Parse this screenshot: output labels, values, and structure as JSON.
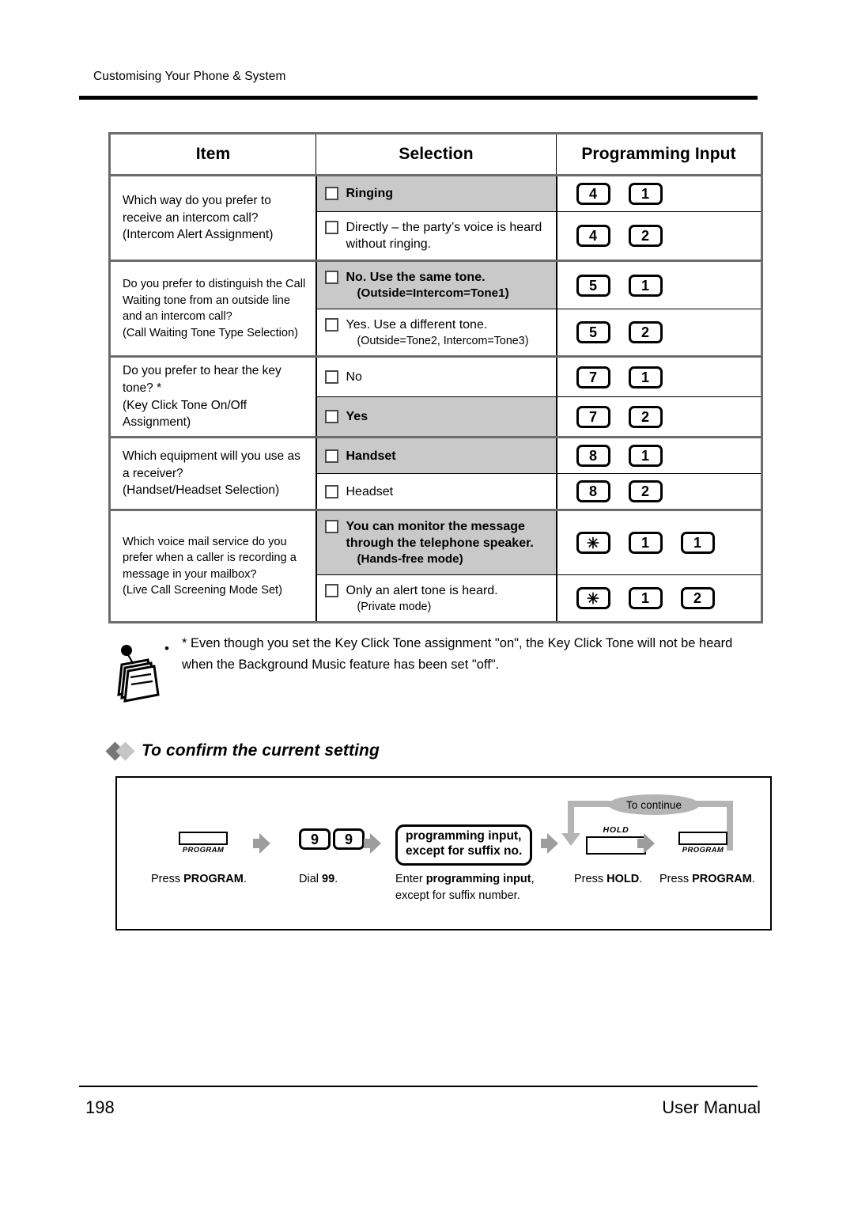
{
  "header": {
    "breadcrumb": "Customising Your Phone & System"
  },
  "table": {
    "columns": [
      "Item",
      "Selection",
      "Programming Input"
    ],
    "rows": [
      {
        "item": "Which way do you prefer to receive an intercom call?",
        "item_sub": "(Intercom Alert Assignment)",
        "options": [
          {
            "label": "Ringing",
            "sub": "",
            "bold": true,
            "shaded": true,
            "keys": [
              "4",
              "1"
            ]
          },
          {
            "label": "Directly – the party’s voice is heard without ringing.",
            "sub": "",
            "bold": false,
            "shaded": false,
            "keys": [
              "4",
              "2"
            ]
          }
        ]
      },
      {
        "item": "Do you prefer to distinguish the Call Waiting tone from an outside line and an intercom call?",
        "item_sub": "(Call Waiting Tone Type Selection)",
        "options": [
          {
            "label": "No.  Use the same tone.",
            "sub": "(Outside=Intercom=Tone1)",
            "bold": true,
            "shaded": true,
            "keys": [
              "5",
              "1"
            ]
          },
          {
            "label": "Yes.  Use a different tone.",
            "sub": "(Outside=Tone2, Intercom=Tone3)",
            "bold": false,
            "shaded": false,
            "keys": [
              "5",
              "2"
            ]
          }
        ]
      },
      {
        "item": "Do you prefer to hear the key tone? *",
        "item_sub": "(Key Click Tone On/Off Assignment)",
        "options": [
          {
            "label": "No",
            "sub": "",
            "bold": false,
            "shaded": false,
            "keys": [
              "7",
              "1"
            ]
          },
          {
            "label": "Yes",
            "sub": "",
            "bold": true,
            "shaded": true,
            "keys": [
              "7",
              "2"
            ]
          }
        ]
      },
      {
        "item": "Which equipment will you use as a receiver?",
        "item_sub": "(Handset/Headset Selection)",
        "options": [
          {
            "label": "Handset",
            "sub": "",
            "bold": true,
            "shaded": true,
            "keys": [
              "8",
              "1"
            ]
          },
          {
            "label": "Headset",
            "sub": "",
            "bold": false,
            "shaded": false,
            "keys": [
              "8",
              "2"
            ]
          }
        ]
      },
      {
        "item": "Which voice mail service do you prefer when a caller is recording a message in your mailbox?",
        "item_sub": "(Live Call Screening Mode Set)",
        "options": [
          {
            "label": "You can monitor the message through the telephone speaker.",
            "sub": "(Hands-free mode)",
            "bold": true,
            "shaded": true,
            "keys": [
              "✳",
              "1",
              "1"
            ]
          },
          {
            "label": "Only an alert tone is heard.",
            "sub": "(Private mode)",
            "bold": false,
            "shaded": false,
            "keys": [
              "✳",
              "1",
              "2"
            ]
          }
        ]
      }
    ]
  },
  "note": {
    "bullet": "•",
    "text": "* Even though you set the Key Click Tone assignment \"on\", the Key Click Tone will not be heard when the Background Music feature has been set \"off\"."
  },
  "section": {
    "heading": "To confirm the current setting"
  },
  "flow": {
    "loop_label": "To continue",
    "steps": [
      {
        "key_type": "program",
        "key_label": "PROGRAM",
        "caption_pre": "Press ",
        "caption_bold": "PROGRAM",
        "caption_post": "."
      },
      {
        "key_type": "dial",
        "keys": [
          "9",
          "9"
        ],
        "caption_pre": "Dial ",
        "caption_bold": "99",
        "caption_post": "."
      },
      {
        "key_type": "inputbox",
        "box_line1": "programming input,",
        "box_line2": "except for suffix no.",
        "caption_pre": "Enter ",
        "caption_bold": "programming input",
        "caption_post": ", ",
        "caption_line2": "except for suffix number."
      },
      {
        "key_type": "hold",
        "key_label": "HOLD",
        "caption_pre": "Press ",
        "caption_bold": "HOLD",
        "caption_post": "."
      },
      {
        "key_type": "program",
        "key_label": "PROGRAM",
        "caption_pre": "Press ",
        "caption_bold": "PROGRAM",
        "caption_post": "."
      }
    ]
  },
  "footer": {
    "page_number": "198",
    "manual_label": "User Manual"
  }
}
